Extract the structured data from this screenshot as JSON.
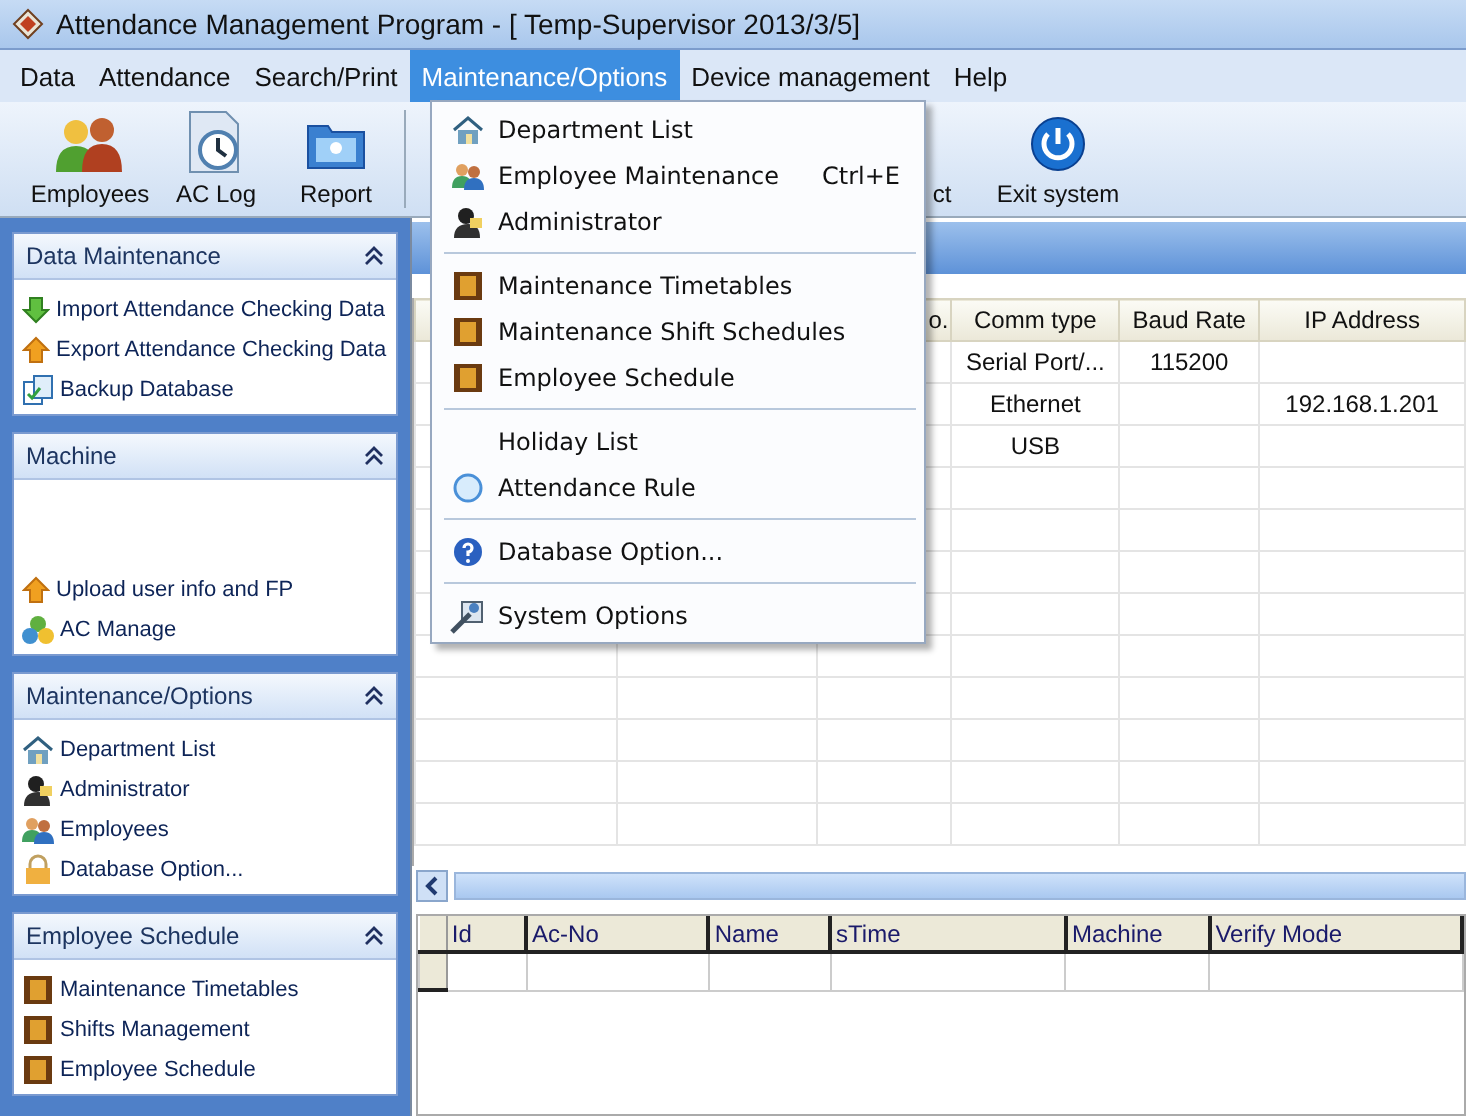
{
  "window": {
    "title": "Attendance Management Program - [ Temp-Supervisor 2013/3/5]"
  },
  "menu_bar": [
    {
      "label": "Data",
      "selected": false
    },
    {
      "label": "Attendance",
      "selected": false
    },
    {
      "label": "Search/Print",
      "selected": false
    },
    {
      "label": "Maintenance/Options",
      "selected": true
    },
    {
      "label": "Device management",
      "selected": false
    },
    {
      "label": "Help",
      "selected": false
    }
  ],
  "toolbar": [
    {
      "label": "Employees"
    },
    {
      "label": "AC Log"
    },
    {
      "label": "Report"
    },
    {
      "label": "ct"
    },
    {
      "label": "Exit system"
    }
  ],
  "sidebar": [
    {
      "title": "Data Maintenance",
      "expanded": true,
      "items": [
        "Import Attendance Checking Data",
        "Export Attendance Checking Data",
        "Backup Database"
      ]
    },
    {
      "title": "Machine",
      "expanded": true,
      "items": [
        "Upload user info and FP",
        "AC Manage"
      ]
    },
    {
      "title": "Maintenance/Options",
      "expanded": true,
      "items": [
        "Department List",
        "Administrator",
        "Employees",
        "Database Option..."
      ]
    },
    {
      "title": "Employee Schedule",
      "expanded": true,
      "items": [
        "Maintenance Timetables",
        "Shifts Management",
        "Employee Schedule"
      ]
    }
  ],
  "machine_table": {
    "columns": [
      "o.",
      "Comm type",
      "Baud Rate",
      "IP Address"
    ],
    "rows": [
      [
        null,
        "Serial Port/...",
        "115200",
        null
      ],
      [
        null,
        "Ethernet",
        null,
        "192.168.1.201"
      ],
      [
        null,
        "USB",
        null,
        null
      ]
    ]
  },
  "log_table": {
    "columns": [
      "Id",
      "Ac-No",
      "Name",
      "sTime",
      "Machine",
      "Verify Mode"
    ]
  },
  "dropdown_menu": {
    "groups": [
      [
        {
          "label": "Department List"
        },
        {
          "label": "Employee Maintenance",
          "shortcut": "Ctrl+E"
        },
        {
          "label": "Administrator"
        }
      ],
      [
        {
          "label": "Maintenance Timetables"
        },
        {
          "label": "Maintenance Shift Schedules"
        },
        {
          "label": "Employee Schedule"
        }
      ],
      [
        {
          "label": "Holiday List"
        },
        {
          "label": "Attendance Rule"
        }
      ],
      [
        {
          "label": "Database Option..."
        }
      ],
      [
        {
          "label": "System Options"
        }
      ]
    ]
  }
}
